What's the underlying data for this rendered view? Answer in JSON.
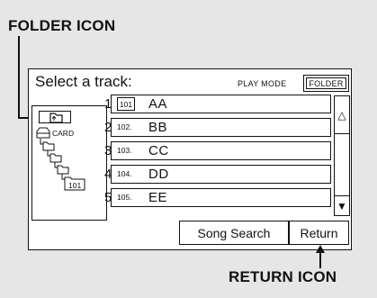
{
  "callouts": {
    "folder_icon": "FOLDER ICON",
    "return_icon": "RETURN ICON"
  },
  "screen": {
    "title": "Select a track:",
    "play_mode_label": "PLAY MODE",
    "play_mode_value": "FOLDER",
    "tree": {
      "card_label": "CARD",
      "folder_number": "101"
    },
    "tracks": [
      {
        "num": "1",
        "badge": "101",
        "name": "AA",
        "is_folder": true
      },
      {
        "num": "2",
        "badge": "102.",
        "name": "BB",
        "is_folder": false
      },
      {
        "num": "3",
        "badge": "103.",
        "name": "CC",
        "is_folder": false
      },
      {
        "num": "4",
        "badge": "104.",
        "name": "DD",
        "is_folder": false
      },
      {
        "num": "5",
        "badge": "105.",
        "name": "EE",
        "is_folder": false
      }
    ],
    "scroll_up_glyph": "△",
    "scroll_down_glyph": "▼",
    "song_search_label": "Song Search",
    "return_label": "Return"
  }
}
